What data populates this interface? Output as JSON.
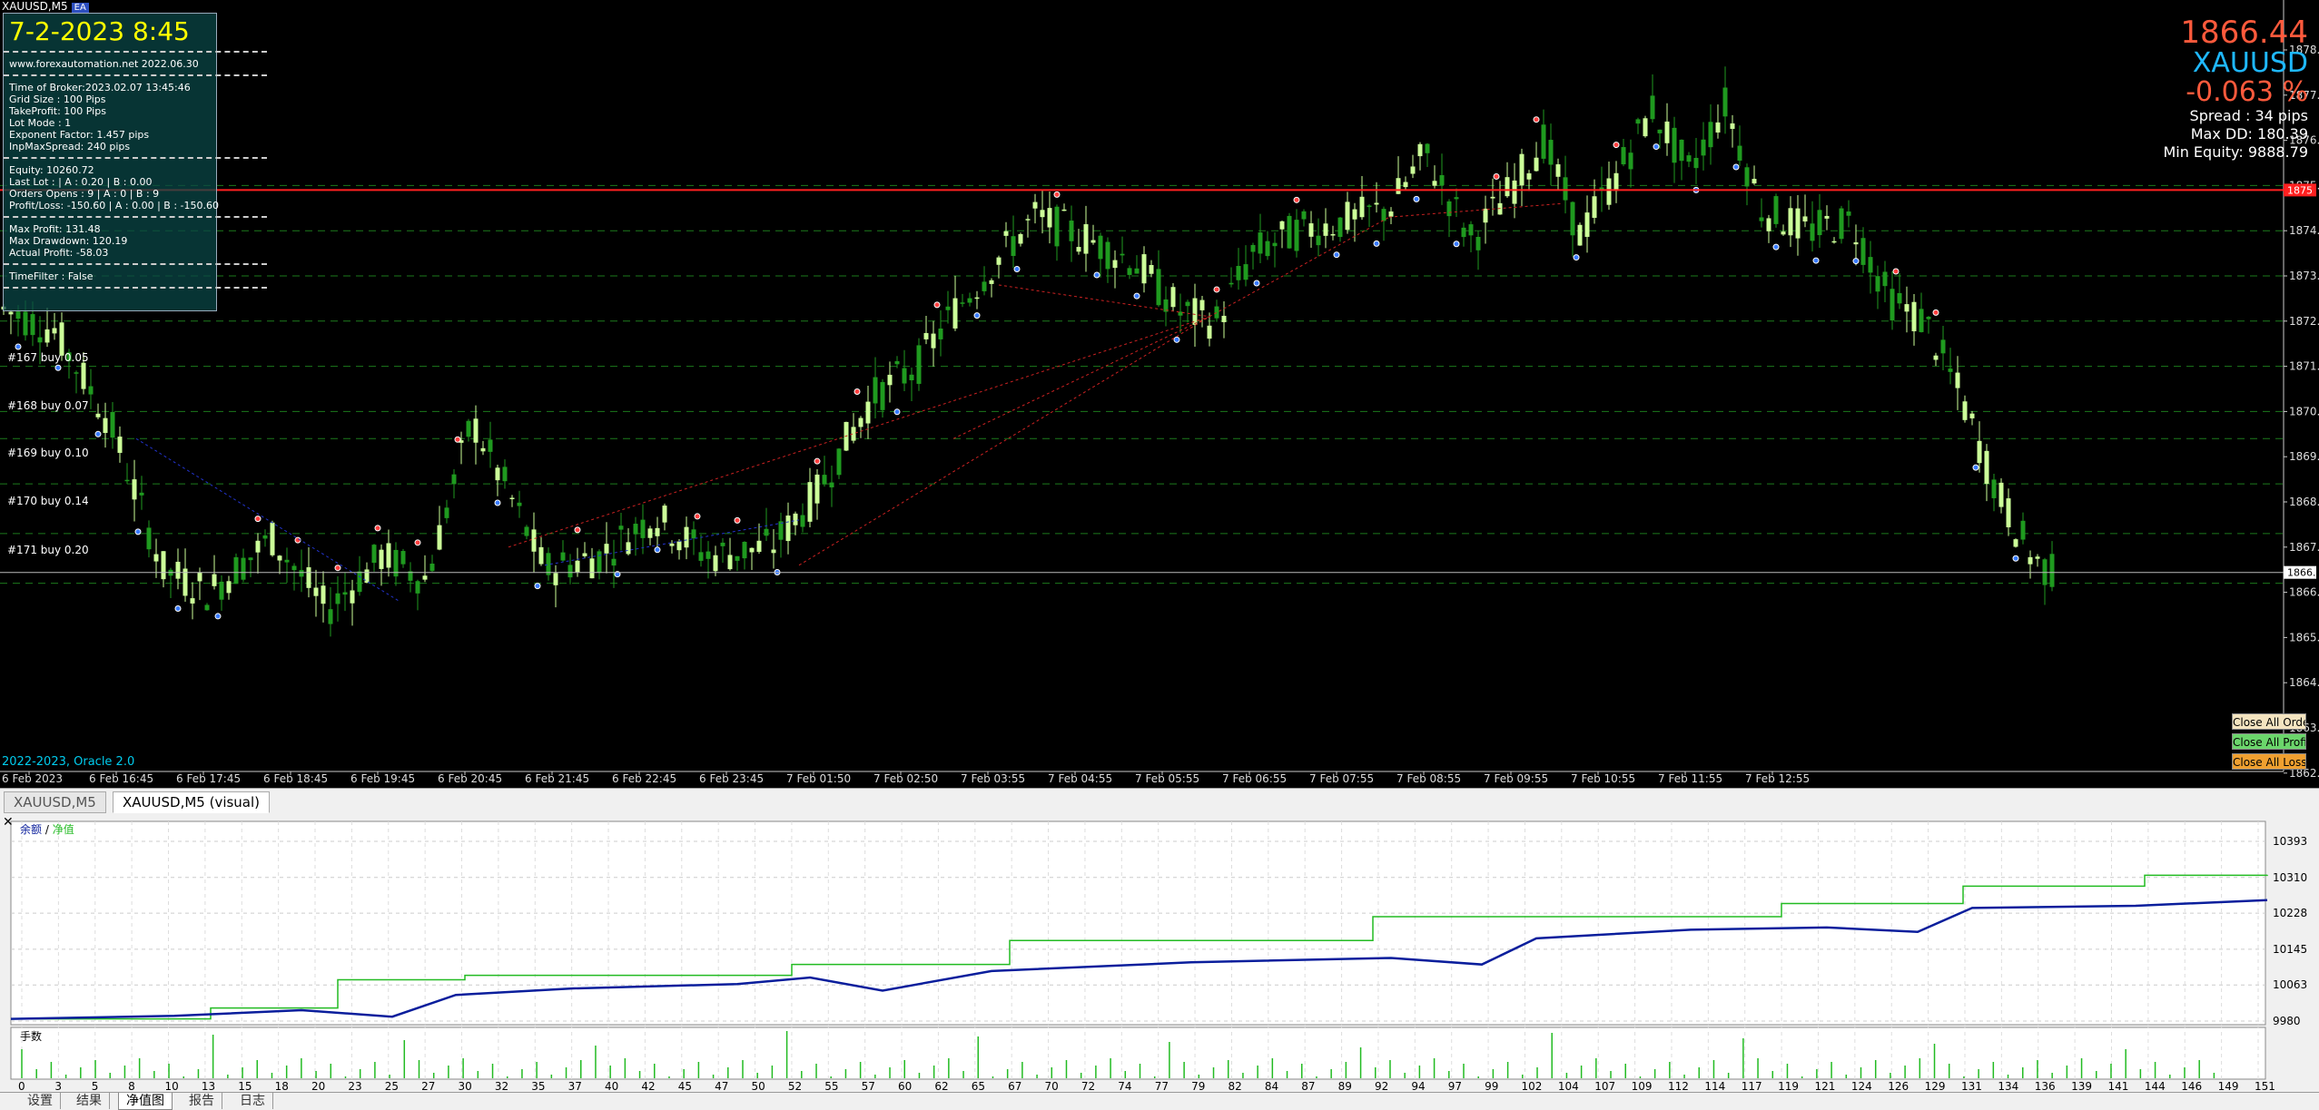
{
  "header": {
    "chart_name": "XAUUSD,M5",
    "tag": "EA"
  },
  "info_panel": {
    "date": "7-2-2023 8:45",
    "site": "www.forexautomation.net 2022.06.30",
    "group1": [
      "Time of Broker:2023.02.07 13:45:46",
      "Grid Size : 100 Pips",
      "TakeProfit: 100 Pips",
      "Lot Mode : 1",
      "Exponent Factor: 1.457 pips",
      "InpMaxSpread: 240 pips"
    ],
    "group2": [
      "Equity:      10260.72",
      "Last Lot : | A : 0.20 | B : 0.00",
      "Orders Opens : 9 | A : 0 | B : 9",
      "Profit/Loss: -150.60 | A : 0.00 | B : -150.60"
    ],
    "group3": [
      "Max Profit: 131.48",
      "Max Drawdown: 120.19",
      "Actual Profit: -58.03"
    ],
    "group4": [
      "TimeFilter : False"
    ]
  },
  "right_info": {
    "price": "1866.44",
    "symbol": "XAUUSD",
    "change": "-0.063 %",
    "spread": "Spread : 34 pips",
    "max_dd": "Max DD: 180.39",
    "min_equity": "Min Equity: 9888.79"
  },
  "buttons": {
    "close_all_orders": "Close All Orders",
    "close_all_profit": "Close All Profit",
    "close_all_losses": "Close All Losses"
  },
  "order_labels": [
    "#167 buy 0.05",
    "#168 buy 0.07",
    "#169 buy 0.10",
    "#170 buy 0.14",
    "#171 buy 0.20"
  ],
  "footer_label": "2022-2023, Oracle 2.0",
  "price_axis": {
    "labels": [
      "1878.",
      "1877.",
      "1876.",
      "1875.",
      "1874.",
      "1873.",
      "1872.",
      "1871.",
      "1870.",
      "1869.",
      "1868.",
      "1867.",
      "1866.",
      "1865.",
      "1864.",
      "1863.",
      "1862."
    ],
    "current_tag": "1866.",
    "red_tag": "1875"
  },
  "time_axis": [
    "6 Feb 2023",
    "6 Feb 16:45",
    "6 Feb 17:45",
    "6 Feb 18:45",
    "6 Feb 19:45",
    "6 Feb 20:45",
    "6 Feb 21:45",
    "6 Feb 22:45",
    "6 Feb 23:45",
    "7 Feb 01:50",
    "7 Feb 02:50",
    "7 Feb 03:55",
    "7 Feb 04:55",
    "7 Feb 05:55",
    "7 Feb 06:55",
    "7 Feb 07:55",
    "7 Feb 08:55",
    "7 Feb 09:55",
    "7 Feb 10:55",
    "7 Feb 11:55",
    "7 Feb 12:55"
  ],
  "chart_tabs": [
    "XAUUSD,M5",
    "XAUUSD,M5 (visual)"
  ],
  "equity_panel": {
    "legend_balance": "余额",
    "legend_sep": " / ",
    "legend_equity": "净值",
    "volume_label": "手数",
    "y_labels": [
      "10393",
      "10310",
      "10228",
      "10145",
      "10063",
      "9980"
    ],
    "x_labels": [
      "0",
      "3",
      "5",
      "8",
      "10",
      "13",
      "15",
      "18",
      "20",
      "23",
      "25",
      "27",
      "30",
      "32",
      "35",
      "37",
      "40",
      "42",
      "45",
      "47",
      "50",
      "52",
      "55",
      "57",
      "60",
      "62",
      "65",
      "67",
      "70",
      "72",
      "74",
      "77",
      "79",
      "82",
      "84",
      "87",
      "89",
      "92",
      "94",
      "97",
      "99",
      "102",
      "104",
      "107",
      "109",
      "112",
      "114",
      "117",
      "119",
      "121",
      "124",
      "126",
      "129",
      "131",
      "134",
      "136",
      "139",
      "141",
      "144",
      "146",
      "149",
      "151"
    ],
    "balance_color": "#0a1e9c",
    "equity_color": "#22bb22"
  },
  "bottom_tabs": [
    "设置",
    "结果",
    "净值图",
    "报告",
    "日志"
  ],
  "colors": {
    "bull": "#ccff99",
    "bear": "#1f9a1f",
    "red_line": "#ff2020",
    "grid_green": "#1c7a1c"
  }
}
